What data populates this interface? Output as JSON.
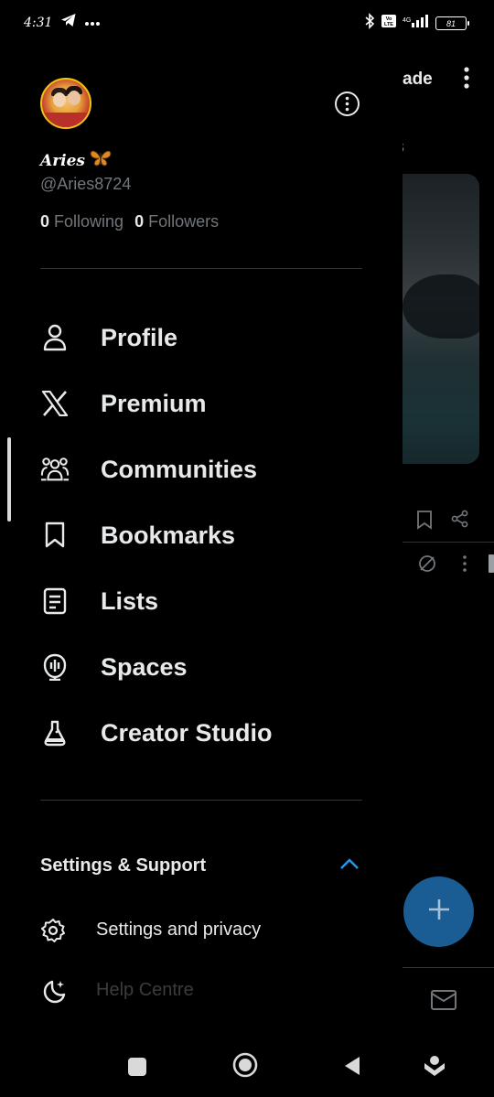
{
  "status_bar": {
    "time": "4:31",
    "battery": "81"
  },
  "background": {
    "header_fragment": "ade",
    "sub_fragment": "s"
  },
  "drawer": {
    "display_name": "Aries",
    "handle": "@Aries8724",
    "following_count": "0",
    "following_label": "Following",
    "followers_count": "0",
    "followers_label": "Followers",
    "nav_items": [
      {
        "label": "Profile",
        "icon": "person-icon"
      },
      {
        "label": "Premium",
        "icon": "x-logo-icon"
      },
      {
        "label": "Communities",
        "icon": "communities-icon"
      },
      {
        "label": "Bookmarks",
        "icon": "bookmark-icon"
      },
      {
        "label": "Lists",
        "icon": "list-icon"
      },
      {
        "label": "Spaces",
        "icon": "spaces-icon"
      },
      {
        "label": "Creator Studio",
        "icon": "flask-icon"
      }
    ],
    "settings_section": {
      "title": "Settings & Support",
      "items": [
        {
          "label": "Settings and privacy",
          "icon": "gear-icon"
        },
        {
          "label": "Help Centre",
          "icon": "moon-icon"
        }
      ]
    }
  },
  "colors": {
    "background": "#000000",
    "text": "#e7e9ea",
    "muted": "#71767b",
    "accent": "#1d9bf0",
    "fab": "#1a5c94"
  }
}
